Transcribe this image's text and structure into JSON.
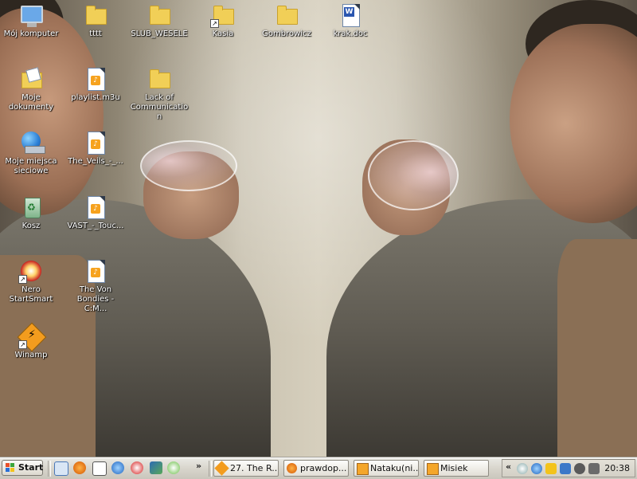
{
  "desktop_icons": [
    {
      "label": "Mój komputer"
    },
    {
      "label": "tttt"
    },
    {
      "label": "SLUB_WESELE"
    },
    {
      "label": "Kasia"
    },
    {
      "label": "Gombrowicz"
    },
    {
      "label": "krak.doc"
    },
    {
      "label": "Moje dokumenty"
    },
    {
      "label": "playlist.m3u"
    },
    {
      "label": "Lack of Communication"
    },
    {
      "label": "Moje miejsca sieciowe"
    },
    {
      "label": "The_Veils_-_..."
    },
    {
      "label": "Kosz"
    },
    {
      "label": "VAST_-_Touc..."
    },
    {
      "label": "Nero StartSmart"
    },
    {
      "label": "The Von Bondies - C:M..."
    },
    {
      "label": "Winamp"
    }
  ],
  "taskbar": {
    "start_label": "Start",
    "overflow_label": "»",
    "tasks": [
      {
        "label": "27. The R..."
      },
      {
        "label": "prawdop..."
      },
      {
        "label": "Nataku(ni..."
      },
      {
        "label": "Misiek"
      }
    ],
    "tray_expand_label": "«",
    "clock": "20:38"
  },
  "colors": {
    "folder": "#f1cf57",
    "taskbar": "#d8d5cc",
    "label_text": "#ffffff"
  }
}
